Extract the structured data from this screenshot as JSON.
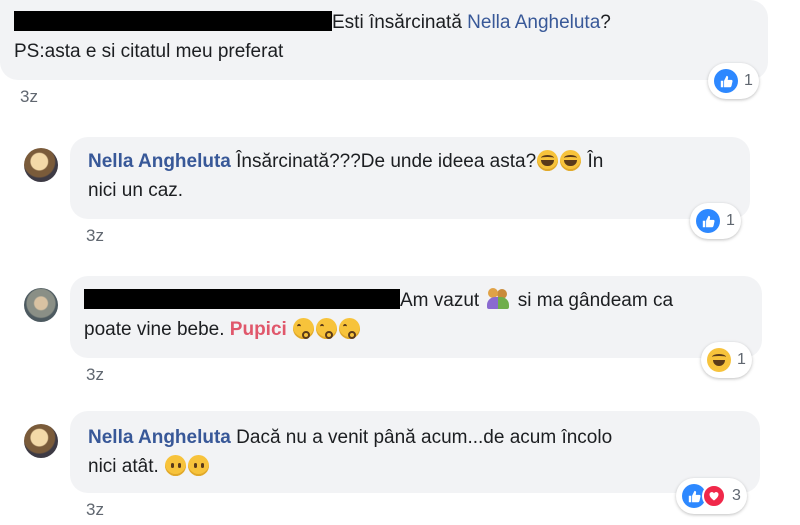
{
  "comments": [
    {
      "author": "",
      "text_1": "Esti însărcinată ",
      "mention": "Nella Angheluta",
      "text_2": "?",
      "line_2": "PS:asta e si citatul meu preferat",
      "time": "3z",
      "reactions": {
        "types": [
          "like-icon"
        ],
        "count": "1"
      }
    },
    {
      "author": "Nella Angheluta",
      "text_1": "Însărcinată???De unde ideea asta?",
      "text_2": "În",
      "line_2": "nici un caz.",
      "time": "3z",
      "reactions": {
        "types": [
          "like-icon"
        ],
        "count": "1"
      }
    },
    {
      "author": "",
      "text_1": "Am vazut ",
      "text_2": " si ma gândeam ca",
      "line_2a": "poate vine bebe. ",
      "mention": "Pupici",
      "time": "3z",
      "reactions": {
        "types": [
          "haha-icon"
        ],
        "count": "1"
      }
    },
    {
      "author": "Nella Angheluta",
      "text_1": "Dacă nu a venit până acum...de acum încolo",
      "line_2": "nici atât. ",
      "time": "3z",
      "reactions": {
        "types": [
          "like-icon",
          "love-icon"
        ],
        "count": "3"
      }
    }
  ],
  "colors": {
    "link": "#385898",
    "bubble": "#f2f3f5",
    "mention_pink": "#e0576b",
    "like": "#2d88ff",
    "love": "#f0284a"
  }
}
